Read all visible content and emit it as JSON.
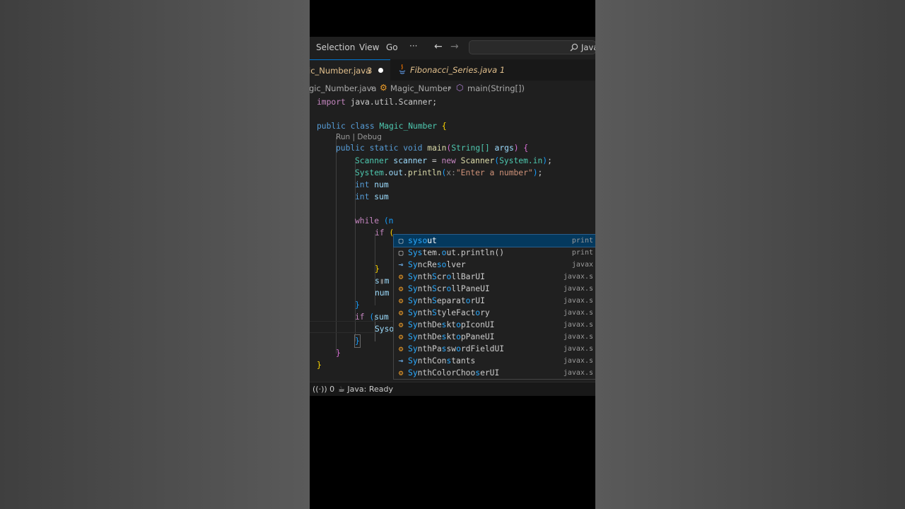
{
  "menu": {
    "selection": "Selection",
    "view": "View",
    "go": "Go",
    "more": "···"
  },
  "nav": {
    "back": "←",
    "forward": "→"
  },
  "search": {
    "icon": "search-icon",
    "text": "Java"
  },
  "tabs": [
    {
      "label": "ic_Number.java",
      "problems": "3",
      "dirty": true
    },
    {
      "label": "Fibonacci_Series.java",
      "problems": "1",
      "icon": "java-file-icon"
    }
  ],
  "breadcrumb": {
    "file": "gic_Number.java",
    "class": "Magic_Number",
    "method": "main(String[])"
  },
  "code": {
    "import_kw": "import",
    "import_path": "java.util.Scanner",
    "public": "public",
    "class_kw": "class",
    "class_name": "Magic_Number",
    "codelens": "Run | Debug",
    "static": "static",
    "void": "void",
    "main": "main",
    "string_type": "String[]",
    "args": "args",
    "scanner_type": "Scanner",
    "scanner_var": "scanner",
    "new_kw": "new",
    "system_in": "System.in",
    "system": "System",
    "out": "out",
    "println": "println",
    "hint_x": "x:",
    "enter_str": "\"Enter a number\"",
    "int_kw": "int",
    "num": "num",
    "sum": "sum",
    "while_kw": "while",
    "while_tail": "(n",
    "if_kw": "if",
    "if_tail": "(",
    "if_sum": "sum",
    "sum_partial": "s",
    "sum_partial_rest": "m",
    "typed": "Syso"
  },
  "suggestions": [
    {
      "icon": "snippet-icon",
      "label": "sysout",
      "match": [
        0,
        4
      ],
      "detail": "print",
      "selected": true
    },
    {
      "icon": "snippet-icon",
      "label": "System.out.println()",
      "detail": "print"
    },
    {
      "icon": "interface-icon",
      "label": "SyncResolver",
      "detail": "javax"
    },
    {
      "icon": "class-icon",
      "label": "SynthScrollBarUI",
      "detail": "javax.s"
    },
    {
      "icon": "class-icon",
      "label": "SynthScrollPaneUI",
      "detail": "javax.s"
    },
    {
      "icon": "class-icon",
      "label": "SynthSeparatorUI",
      "detail": "javax.s"
    },
    {
      "icon": "class-icon",
      "label": "SynthStyleFactory",
      "detail": "javax.s"
    },
    {
      "icon": "class-icon",
      "label": "SynthDesktopIconUI",
      "detail": "javax.s"
    },
    {
      "icon": "class-icon",
      "label": "SynthDesktopPaneUI",
      "detail": "javax.s"
    },
    {
      "icon": "class-icon",
      "label": "SynthPasswordFieldUI",
      "detail": "javax.s"
    },
    {
      "icon": "interface-icon",
      "label": "SynthConstants",
      "detail": "javax.s"
    },
    {
      "icon": "class-icon",
      "label": "SynthColorChooserUI",
      "detail": "javax.s"
    }
  ],
  "statusbar": {
    "ports": "0",
    "java_status": "Java: Ready"
  }
}
